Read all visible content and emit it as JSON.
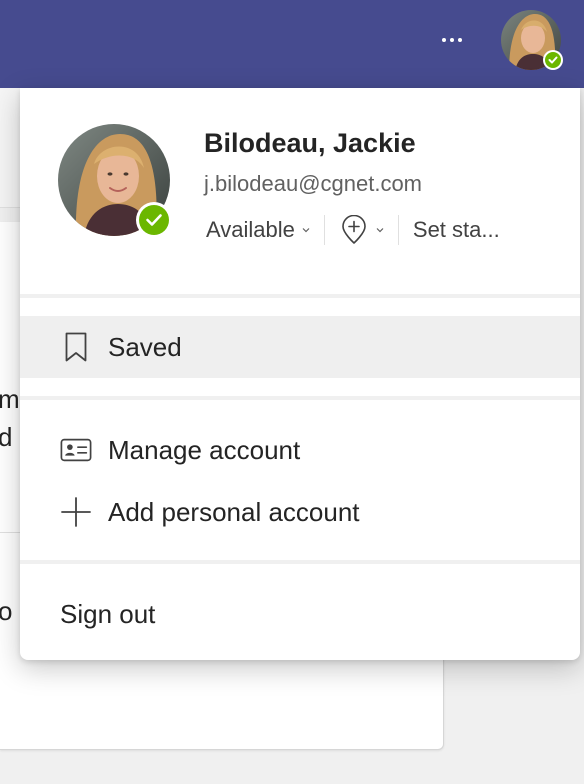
{
  "topbar": {
    "more_icon": "more-horizontal-icon",
    "avatar_status": "available"
  },
  "background": {
    "text_fragments": [
      "m",
      "d",
      "o"
    ]
  },
  "profile": {
    "name": "Bilodeau, Jackie",
    "email": "j.bilodeau@cgnet.com",
    "status": "Available",
    "set_status": "Set sta...",
    "status_color": "#6bb700",
    "location_icon": "location-add-icon"
  },
  "menu": {
    "saved": {
      "label": "Saved",
      "icon": "bookmark-icon"
    },
    "manage_account": {
      "label": "Manage account",
      "icon": "contact-card-icon"
    },
    "add_personal_account": {
      "label": "Add personal account",
      "icon": "plus-icon"
    },
    "sign_out": {
      "label": "Sign out"
    }
  },
  "colors": {
    "header": "#464b8f",
    "selected_item": "#efefef",
    "available": "#6bb700"
  }
}
